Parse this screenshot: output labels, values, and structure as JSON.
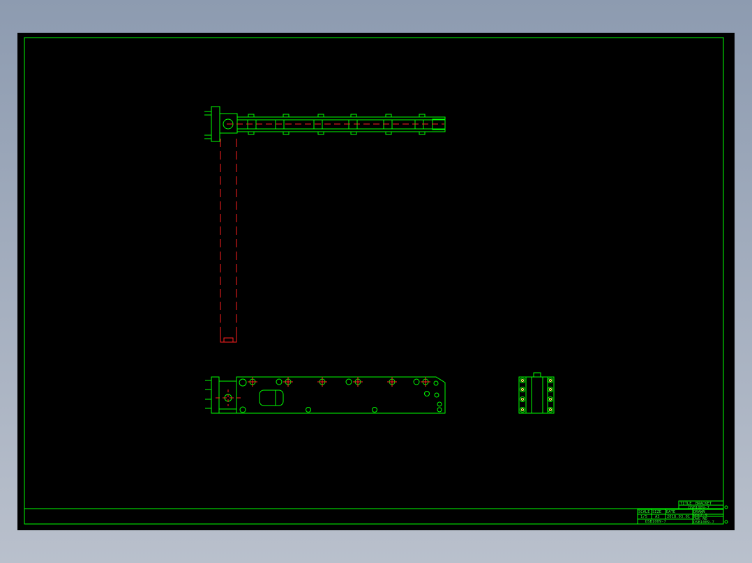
{
  "colors": {
    "background": "#000000",
    "outline": "#00ff00",
    "centerline": "#ff2020",
    "circle_detail": "#ffff66",
    "titleblock_text": "#33ff33"
  },
  "title_block": {
    "title_label": "TITLE",
    "title_value": "BRACKET",
    "part_no": "DSB1009-7",
    "scale_label": "SCALE",
    "scale_value": "1/5",
    "size_label": "SIZE",
    "size_value": "A3",
    "date_label": "DATE",
    "date_value": "2018.03.01",
    "drawn_label": "DRAWN",
    "drawn_value": "RDGZ-9",
    "dwg_label": "DWG NO",
    "dwg_value": "DSB1009-7",
    "sheet_marks": "DSB1009-7",
    "sheet_no_1": "0",
    "sheet_no_2": "0"
  }
}
